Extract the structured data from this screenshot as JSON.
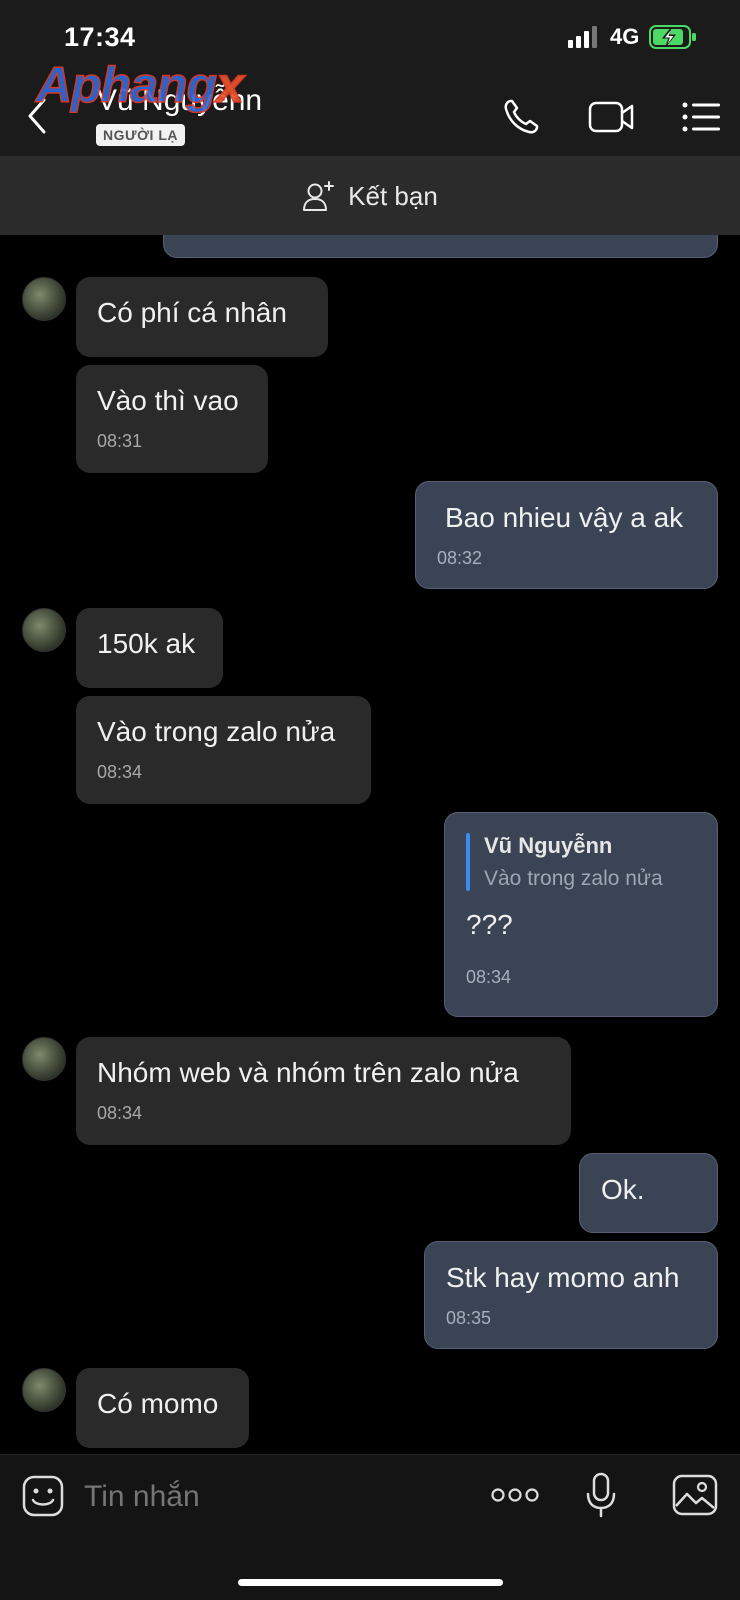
{
  "status": {
    "time": "17:34",
    "network": "4G"
  },
  "header": {
    "watermark": "Aphangx",
    "contact_name": "Vũ Nguyễnn",
    "badge": "NGƯỜI LẠ"
  },
  "friend_bar": {
    "label": "Kết bạn"
  },
  "messages": [
    {
      "side": "in",
      "text": "Có phí cá nhân",
      "time": ""
    },
    {
      "side": "in",
      "text": "Vào thì vao",
      "time": "08:31"
    },
    {
      "side": "out",
      "text": "Bao nhieu vậy a ak",
      "time": "08:32"
    },
    {
      "side": "in",
      "text": "150k ak",
      "time": ""
    },
    {
      "side": "in",
      "text": "Vào trong zalo nửa",
      "time": "08:34"
    },
    {
      "side": "out",
      "quote_name": "Vũ Nguyễnn",
      "quote_text": "Vào trong zalo nửa",
      "text": "???",
      "time": "08:34"
    },
    {
      "side": "in",
      "text": "Nhóm web và nhóm trên zalo nửa",
      "time": "08:34"
    },
    {
      "side": "out",
      "text": "Ok.",
      "time": ""
    },
    {
      "side": "out",
      "text": "Stk hay momo anh",
      "time": "08:35"
    },
    {
      "side": "in",
      "text": "Có momo",
      "time": ""
    }
  ],
  "composer": {
    "placeholder": "Tin nhắn"
  },
  "colors": {
    "accent": "#3d8bf2",
    "battery": "#4cd964",
    "outgoing_bubble": "#3b4454",
    "incoming_bubble": "#2a2a2a"
  }
}
